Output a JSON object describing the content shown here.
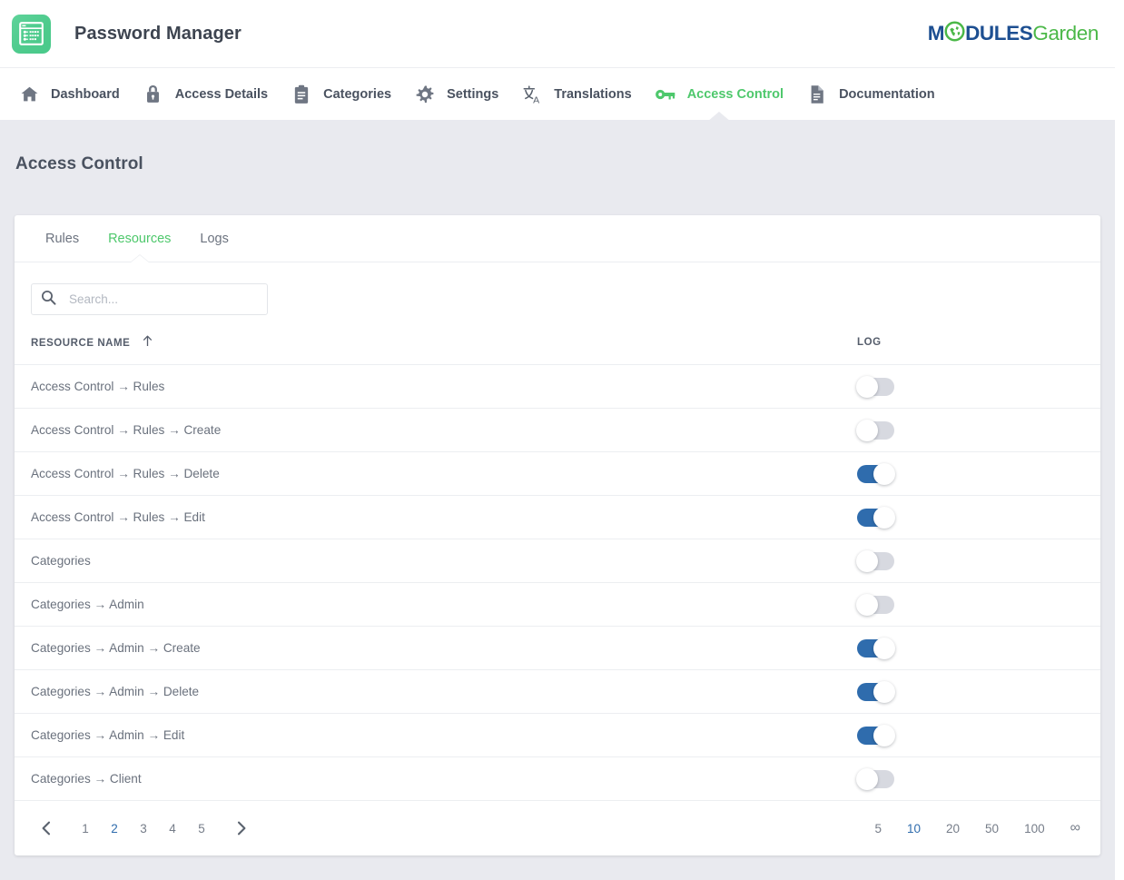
{
  "header": {
    "app_title": "Password Manager",
    "app_icon": "password-window-icon",
    "logo": {
      "part1": "M",
      "globe": "globe-icon",
      "part2": "DULES",
      "part3": "Garden"
    }
  },
  "nav": {
    "items": [
      {
        "label": "Dashboard",
        "icon": "home-icon",
        "active": false
      },
      {
        "label": "Access Details",
        "icon": "lock-icon",
        "active": false
      },
      {
        "label": "Categories",
        "icon": "clipboard-icon",
        "active": false
      },
      {
        "label": "Settings",
        "icon": "gear-icon",
        "active": false
      },
      {
        "label": "Translations",
        "icon": "translate-icon",
        "active": false
      },
      {
        "label": "Access Control",
        "icon": "key-icon",
        "active": true
      },
      {
        "label": "Documentation",
        "icon": "document-icon",
        "active": false
      }
    ]
  },
  "page": {
    "title": "Access Control"
  },
  "tabs": [
    {
      "label": "Rules",
      "active": false
    },
    {
      "label": "Resources",
      "active": true
    },
    {
      "label": "Logs",
      "active": false
    }
  ],
  "search": {
    "value": "",
    "placeholder": "Search..."
  },
  "table": {
    "columns": [
      {
        "key": "name",
        "label": "RESOURCE NAME",
        "sort": "asc"
      },
      {
        "key": "log",
        "label": "LOG"
      }
    ],
    "rows": [
      {
        "name": "Access Control → Rules",
        "log": false
      },
      {
        "name": "Access Control → Rules → Create",
        "log": false
      },
      {
        "name": "Access Control → Rules → Delete",
        "log": true
      },
      {
        "name": "Access Control → Rules → Edit",
        "log": true
      },
      {
        "name": "Categories",
        "log": false
      },
      {
        "name": "Categories → Admin",
        "log": false
      },
      {
        "name": "Categories → Admin → Create",
        "log": true
      },
      {
        "name": "Categories → Admin → Delete",
        "log": true
      },
      {
        "name": "Categories → Admin → Edit",
        "log": true
      },
      {
        "name": "Categories → Client",
        "log": false
      }
    ]
  },
  "pagination": {
    "prev_icon": "chevron-left-icon",
    "next_icon": "chevron-right-icon",
    "pages": [
      "1",
      "2",
      "3",
      "4",
      "5"
    ],
    "current_page": "2",
    "page_sizes": [
      "5",
      "10",
      "20",
      "50",
      "100",
      "∞"
    ],
    "current_page_size": "10"
  },
  "colors": {
    "accent_green": "#4ec86c",
    "toggle_on_blue": "#2f6cad",
    "toggle_off_gray": "#d7d9e0",
    "link_blue": "#2f6cad",
    "page_bg": "#e9eaef",
    "text": "#4a5260",
    "logo_blue": "#1d4f91",
    "logo_green": "#4bb848"
  }
}
